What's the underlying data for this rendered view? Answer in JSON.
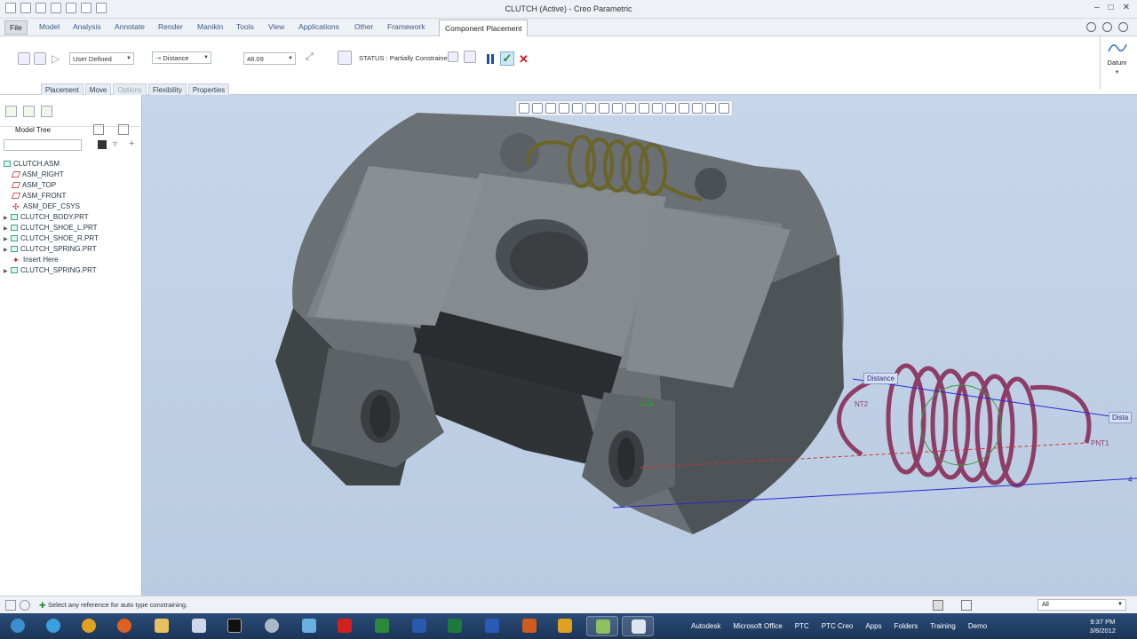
{
  "window": {
    "title": "CLUTCH (Active) - Creo Parametric"
  },
  "menu": {
    "file": "File",
    "tabs": [
      "Model",
      "Analysis",
      "Annotate",
      "Render",
      "Manikin",
      "Tools",
      "View",
      "Applications",
      "Other",
      "Framework"
    ],
    "active_tab": "Component Placement"
  },
  "ribbon": {
    "constraint_set": "User Defined",
    "constraint_type": "Distance",
    "offset_value": "48.09",
    "status": "STATUS : Partially Constrained",
    "subtabs": [
      "Placement",
      "Move",
      "Options",
      "Flexibility",
      "Properties"
    ],
    "datum_label": "Datum"
  },
  "tree": {
    "title": "Model Tree",
    "items": [
      {
        "label": "CLUTCH.ASM",
        "type": "asm",
        "level": 0
      },
      {
        "label": "ASM_RIGHT",
        "type": "plane",
        "level": 1
      },
      {
        "label": "ASM_TOP",
        "type": "plane",
        "level": 1
      },
      {
        "label": "ASM_FRONT",
        "type": "plane",
        "level": 1
      },
      {
        "label": "ASM_DEF_CSYS",
        "type": "csys",
        "level": 1
      },
      {
        "label": "CLUTCH_BODY.PRT",
        "type": "part",
        "level": 1
      },
      {
        "label": "CLUTCH_SHOE_L.PRT",
        "type": "part",
        "level": 1
      },
      {
        "label": "CLUTCH_SHOE_R.PRT",
        "type": "part",
        "level": 1
      },
      {
        "label": "CLUTCH_SPRING.PRT",
        "type": "part",
        "level": 1
      },
      {
        "label": "Insert Here",
        "type": "insert",
        "level": 1
      },
      {
        "label": "CLUTCH_SPRING.PRT",
        "type": "part",
        "level": 1
      }
    ]
  },
  "viewport": {
    "labels": {
      "distance": "Distance",
      "distance_right": "Dista",
      "pnt1": "PNT1",
      "pnt2": "NT2",
      "axis_value": "4"
    }
  },
  "statusbar": {
    "message": "Select any reference for auto type constraining.",
    "filter": "All"
  },
  "taskbar": {
    "links": [
      "Autodesk",
      "Microsoft Office",
      "PTC",
      "PTC Creo",
      "Apps",
      "Folders",
      "Training",
      "Demo"
    ],
    "time": "9:37 PM",
    "date": "3/8/2012"
  }
}
